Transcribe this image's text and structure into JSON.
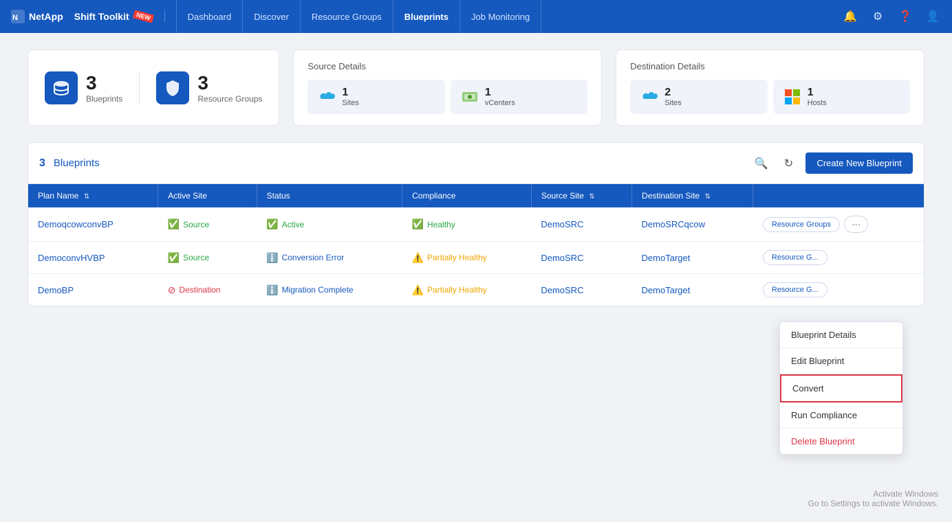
{
  "navbar": {
    "brand": "NetApp",
    "toolkit": "Shift Toolkit",
    "links": [
      {
        "label": "Dashboard",
        "active": false
      },
      {
        "label": "Discover",
        "active": false
      },
      {
        "label": "Resource Groups",
        "active": false
      },
      {
        "label": "Blueprints",
        "active": true
      },
      {
        "label": "Job Monitoring",
        "active": false
      }
    ],
    "icons": [
      "bell",
      "gear",
      "question",
      "user"
    ]
  },
  "stats": {
    "blueprints_count": "3",
    "blueprints_label": "Blueprints",
    "resource_groups_count": "3",
    "resource_groups_label": "Resource Groups"
  },
  "source_details": {
    "title": "Source Details",
    "items": [
      {
        "count": "1",
        "label": "Sites"
      },
      {
        "count": "1",
        "label": "vCenters"
      }
    ]
  },
  "destination_details": {
    "title": "Destination Details",
    "items": [
      {
        "count": "2",
        "label": "Sites"
      },
      {
        "count": "1",
        "label": "Hosts"
      }
    ]
  },
  "blueprints_section": {
    "count": "3",
    "title": "Blueprints",
    "create_btn": "Create New Blueprint"
  },
  "table": {
    "columns": [
      {
        "label": "Plan Name",
        "sortable": true
      },
      {
        "label": "Active Site",
        "sortable": false
      },
      {
        "label": "Status",
        "sortable": false
      },
      {
        "label": "Compliance",
        "sortable": false
      },
      {
        "label": "Source Site",
        "sortable": true
      },
      {
        "label": "Destination Site",
        "sortable": true
      },
      {
        "label": "",
        "sortable": false
      }
    ],
    "rows": [
      {
        "plan_name": "DemoqcowconvBP",
        "active_site": "Source",
        "active_site_type": "green",
        "status": "Active",
        "status_type": "green",
        "compliance": "Healthy",
        "compliance_type": "green",
        "source_site": "DemoSRC",
        "destination_site": "DemoSRCqcow",
        "action_btn": "Resource Groups",
        "show_more": true
      },
      {
        "plan_name": "DemoconvHVBP",
        "active_site": "Source",
        "active_site_type": "green",
        "status": "Conversion Error",
        "status_type": "info",
        "compliance": "Partially Healthy",
        "compliance_type": "yellow",
        "source_site": "DemoSRC",
        "destination_site": "DemoTarget",
        "action_btn": "Resource G...",
        "show_more": false
      },
      {
        "plan_name": "DemoBP",
        "active_site": "Destination",
        "active_site_type": "red",
        "status": "Migration Complete",
        "status_type": "info",
        "compliance": "Partially Healthy",
        "compliance_type": "yellow",
        "source_site": "DemoSRC",
        "destination_site": "DemoTarget",
        "action_btn": "Resource G...",
        "show_more": false
      }
    ]
  },
  "dropdown": {
    "items": [
      {
        "label": "Blueprint Details",
        "type": "normal"
      },
      {
        "label": "Edit Blueprint",
        "type": "normal"
      },
      {
        "label": "Convert",
        "type": "highlighted"
      },
      {
        "label": "Run Compliance",
        "type": "normal"
      },
      {
        "label": "Delete Blueprint",
        "type": "danger"
      }
    ]
  },
  "activate_windows": {
    "line1": "Activate Windows",
    "line2": "Go to Settings to activate Windows."
  }
}
